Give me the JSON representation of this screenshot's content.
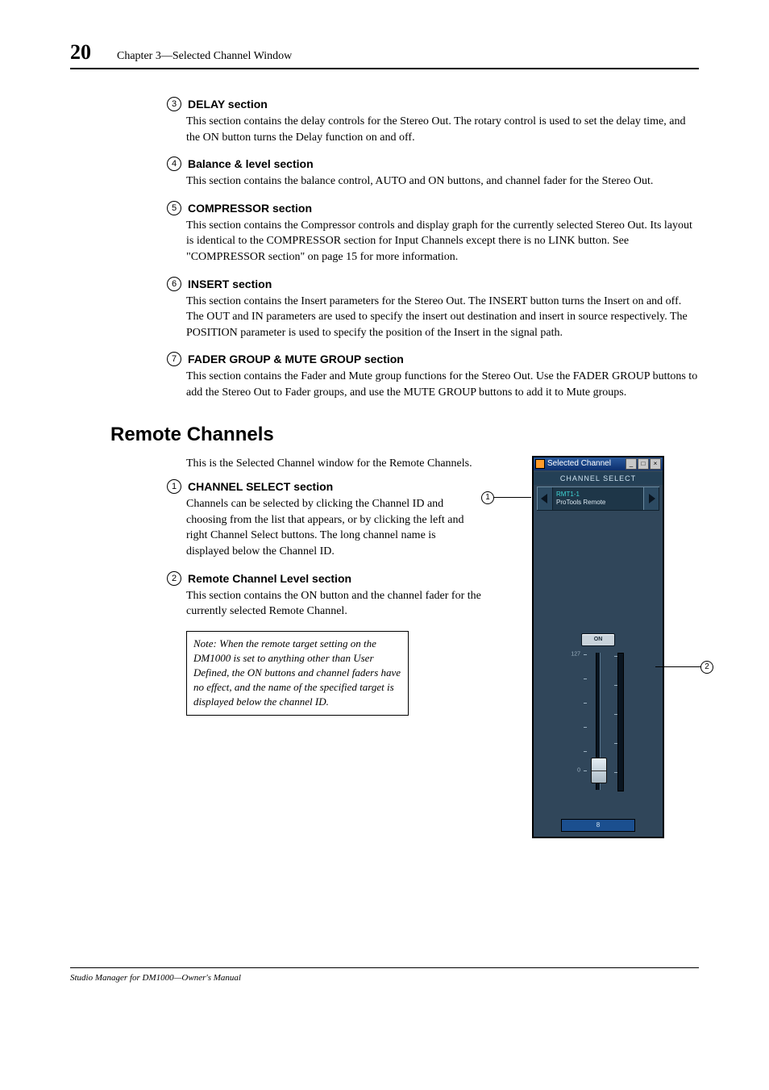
{
  "page_number": "20",
  "chapter_title": "Chapter 3—Selected Channel Window",
  "items_top": [
    {
      "num": "3",
      "title": "DELAY section",
      "body": "This section contains the delay controls for the Stereo Out. The rotary control is used to set the delay time, and the ON button turns the Delay function on and off."
    },
    {
      "num": "4",
      "title": "Balance & level section",
      "body": "This section contains the balance control, AUTO and ON buttons, and channel fader for the Stereo Out."
    },
    {
      "num": "5",
      "title": "COMPRESSOR section",
      "body": "This section contains the Compressor controls and display graph for the currently selected Stereo Out. Its layout is identical to the COMPRESSOR section for Input Channels except there is no LINK button. See \"COMPRESSOR section\" on page 15 for more information."
    },
    {
      "num": "6",
      "title": "INSERT section",
      "body": "This section contains the Insert parameters for the Stereo Out. The INSERT button turns the Insert on and off. The OUT and IN parameters are used to specify the insert out destination and insert in source respectively. The POSITION parameter is used to specify the position of the Insert in the signal path."
    },
    {
      "num": "7",
      "title": "FADER GROUP & MUTE GROUP section",
      "body": "This section contains the Fader and Mute group functions for the Stereo Out. Use the FADER GROUP buttons to add the Stereo Out to Fader groups, and use the MUTE GROUP buttons to add it to Mute groups."
    }
  ],
  "section_heading": "Remote Channels",
  "remote_intro": "This is the Selected Channel window for the Remote Channels.",
  "items_remote": [
    {
      "num": "1",
      "title": "CHANNEL SELECT section",
      "body": "Channels can be selected by clicking the Channel ID and choosing from the list that appears, or by clicking the left and right Channel Select buttons. The long channel name is displayed below the Channel ID."
    },
    {
      "num": "2",
      "title": "Remote Channel Level section",
      "body": "This section contains the ON button and the channel fader for the currently selected Remote Channel."
    }
  ],
  "note_text": "Note: When the remote target setting on the DM1000 is set to anything other than User Defined, the ON buttons and channel faders have no effect, and the name of the specified target is displayed below the channel ID.",
  "app": {
    "title": "Selected Channel",
    "ch_select_label": "CHANNEL SELECT",
    "ch_id_line1": "RMT1-1",
    "ch_id_line2": "ProTools Remote",
    "on_label": "ON",
    "scale_top": "127",
    "scale_zero": "0",
    "channel_name": "8"
  },
  "annotations": {
    "a1": "1",
    "a2": "2"
  },
  "footer": "Studio Manager for DM1000—Owner's Manual"
}
